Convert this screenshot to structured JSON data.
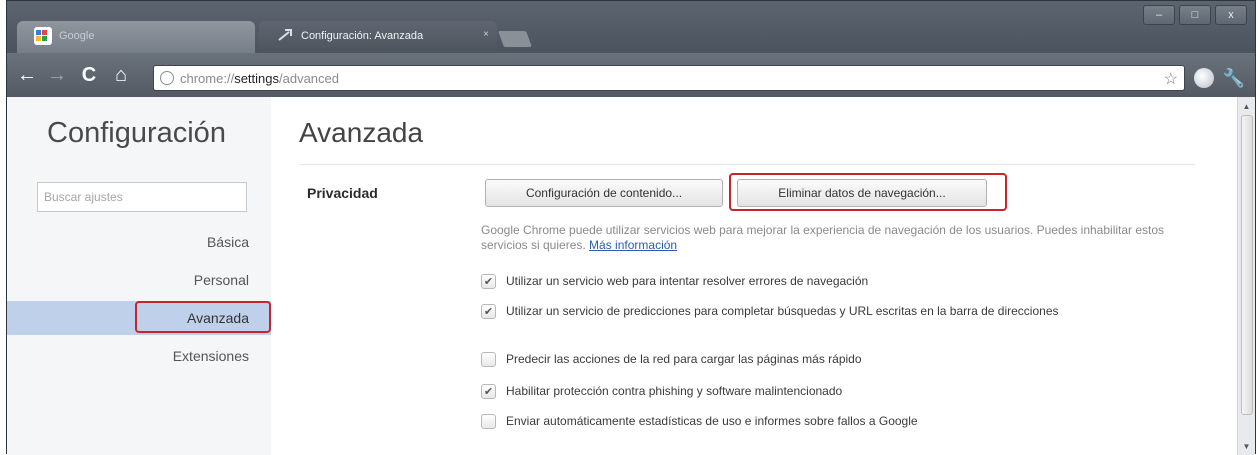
{
  "browser": {
    "tabs": [
      {
        "label": "Google",
        "favicon": "google-favicon",
        "active": false
      },
      {
        "label": "Configuración: Avanzada",
        "favicon": "settings-favicon",
        "active": true
      }
    ],
    "window_controls": {
      "minimize": "–",
      "maximize": "□",
      "close": "x"
    },
    "url_prefix": "chrome://",
    "url_host": "settings",
    "url_path": "/advanced",
    "icons": {
      "back": "←",
      "forward": "→",
      "reload": "C",
      "home": "⌂",
      "star": "☆",
      "wrench": "🔧"
    }
  },
  "sidebar": {
    "title": "Configuración",
    "search_placeholder": "Buscar ajustes",
    "items": [
      {
        "label": "Básica",
        "active": false
      },
      {
        "label": "Personal",
        "active": false
      },
      {
        "label": "Avanzada",
        "active": true
      },
      {
        "label": "Extensiones",
        "active": false
      }
    ]
  },
  "main": {
    "title": "Avanzada",
    "section_label": "Privacidad",
    "button_content": "Configuración de contenido...",
    "button_clear": "Eliminar datos de navegación...",
    "description": "Google Chrome puede utilizar servicios web para mejorar la experiencia de navegación de los usuarios. Puedes inhabilitar estos servicios si quieres.",
    "description_link": "Más información",
    "options": [
      {
        "label": "Utilizar un servicio web para intentar resolver errores de navegación",
        "checked": true
      },
      {
        "label": "Utilizar un servicio de predicciones para completar búsquedas y URL escritas en la barra de direcciones",
        "checked": true
      },
      {
        "label": "Predecir las acciones de la red para cargar las páginas más rápido",
        "checked": false
      },
      {
        "label": "Habilitar protección contra phishing y software malintencionado",
        "checked": true
      },
      {
        "label": "Enviar automáticamente estadísticas de uso e informes sobre fallos a Google",
        "checked": false
      }
    ]
  },
  "colors": {
    "highlight_box": "#c9242b",
    "active_nav": "#bfd1ea",
    "link": "#2a5db0"
  }
}
